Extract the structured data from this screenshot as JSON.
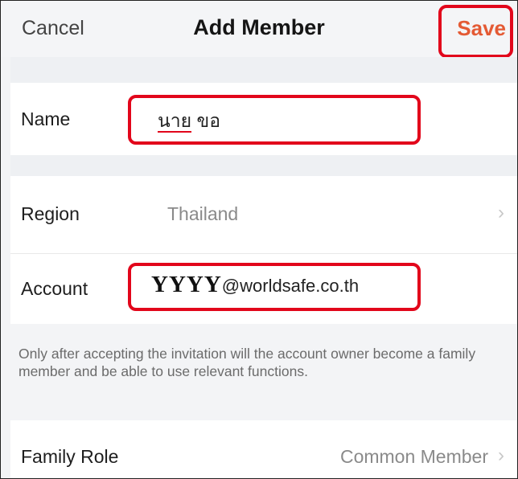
{
  "header": {
    "cancel_label": "Cancel",
    "title": "Add Member",
    "save_label": "Save"
  },
  "form": {
    "name": {
      "label": "Name",
      "value_underlined": "นาย",
      "value_rest": " ขอ"
    },
    "region": {
      "label": "Region",
      "value": "Thailand"
    },
    "account": {
      "label": "Account",
      "value_bold": "YYYY",
      "value_rest": "@worldsafe.co.th"
    },
    "note": "Only after accepting the invitation will the account owner become a family member and be able to use relevant functions.",
    "family_role": {
      "label": "Family Role",
      "value": "Common Member"
    }
  },
  "icons": {
    "chevron": "chevron-right-icon"
  },
  "colors": {
    "accent": "#e45a34",
    "highlight": "#e2061b",
    "background": "#f3f4f6"
  }
}
